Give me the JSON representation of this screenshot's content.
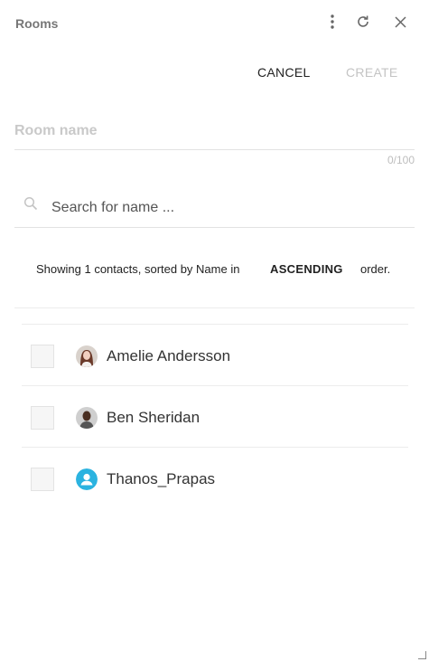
{
  "header": {
    "title": "Rooms",
    "icons": [
      "more-vert-icon",
      "refresh-icon",
      "close-icon"
    ]
  },
  "actions": {
    "cancel_label": "CANCEL",
    "create_label": "CREATE"
  },
  "room_name": {
    "placeholder": "Room name",
    "value": "",
    "counter": "0/100"
  },
  "search": {
    "placeholder": "Search for name ...",
    "value": ""
  },
  "sort_info": {
    "prefix": "Showing 1 contacts, sorted by Name in",
    "order": "ASCENDING",
    "suffix": "order."
  },
  "contacts": [
    {
      "name": "Amelie Andersson",
      "avatar": "photo-avatar"
    },
    {
      "name": "Ben Sheridan",
      "avatar": "photo-avatar"
    },
    {
      "name": "Thanos_Prapas",
      "avatar": "default-user-icon"
    }
  ],
  "colors": {
    "accent": "#2bb3e0",
    "disabled": "#c4c4c4"
  }
}
